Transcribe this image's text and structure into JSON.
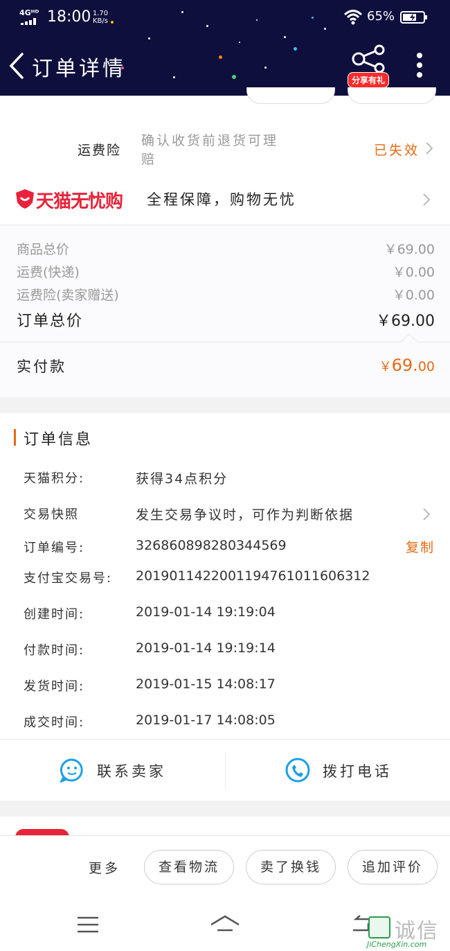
{
  "status_bar": {
    "network": "4Gᴴᴰ",
    "time": "18:00",
    "speed": "1.70",
    "speed_unit": "KB/s",
    "battery": "65%"
  },
  "header": {
    "title": "订单详情",
    "share_badge": "分享有礼",
    "back_icon": "chevron-left-icon",
    "share_icon": "share-icon",
    "more_icon": "more-vertical-icon"
  },
  "insurance": {
    "label": "运费险",
    "desc_line1": "确认收货前退货可理",
    "desc_line2": "赔",
    "status": "已失效"
  },
  "tmall": {
    "brand": "天猫无忧购",
    "slogan": "全程保障，购物无忧"
  },
  "prices": {
    "items": [
      {
        "label": "商品总价",
        "value": "￥69.00"
      },
      {
        "label": "运费(快递)",
        "value": "￥0.00"
      },
      {
        "label": "运费险(卖家赠送)",
        "value": "￥0.00"
      }
    ],
    "total_label": "订单总价",
    "total_value": "￥69.00",
    "paid_label": "实付款",
    "paid_currency": "￥",
    "paid_int": "69.",
    "paid_dec": "00"
  },
  "order_info": {
    "title": "订单信息",
    "points_label": "天猫积分:",
    "points_value": "获得34点积分",
    "snapshot_label": "交易快照",
    "snapshot_value": "发生交易争议时，可作为判断依据",
    "order_no_label": "订单编号:",
    "order_no_value": "326860898280344569",
    "copy_label": "复制",
    "alipay_label": "支付宝交易号:",
    "alipay_value": "2019011422001194761011606312",
    "created_label": "创建时间:",
    "created_value": "2019-01-14 19:19:04",
    "paid_time_label": "付款时间:",
    "paid_time_value": "2019-01-14 19:19:14",
    "shipped_label": "发货时间:",
    "shipped_value": "2019-01-15 14:08:17",
    "completed_label": "成交时间:",
    "completed_value": "2019-01-17 14:08:05"
  },
  "contact": {
    "seller_label": "联系卖家",
    "call_label": "拨打电话"
  },
  "bottom_bar": {
    "more_label": "更多",
    "logistics_label": "查看物流",
    "resell_label": "卖了换钱",
    "review_label": "追加评价"
  },
  "watermark": {
    "brand": "诚信",
    "site": "JiChengXin.com"
  },
  "colors": {
    "header_bg": "#0e0f3d",
    "accent": "#e86a12",
    "tmall_red": "#e8233a",
    "contact_blue": "#1a9fe8"
  }
}
